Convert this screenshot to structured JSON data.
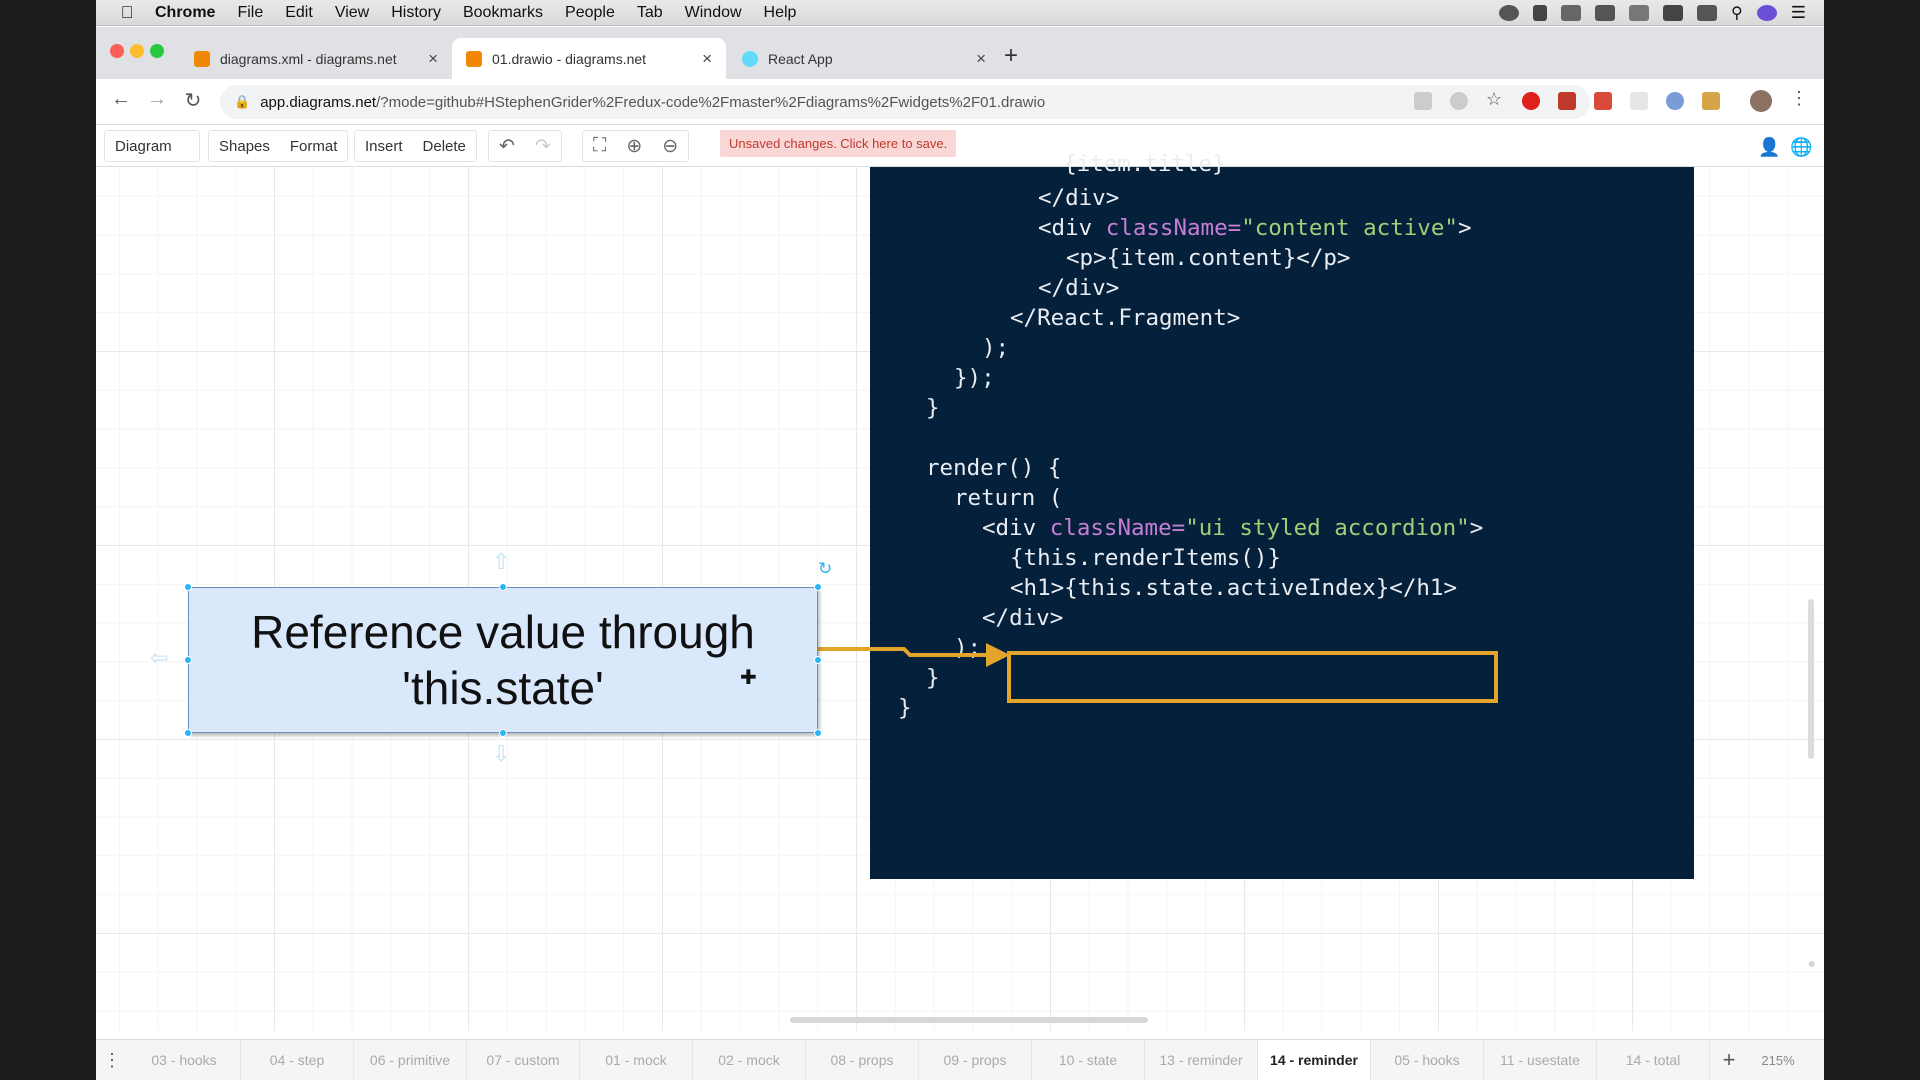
{
  "menubar": {
    "app": "Chrome",
    "items": [
      "File",
      "Edit",
      "View",
      "History",
      "Bookmarks",
      "People",
      "Tab",
      "Window",
      "Help"
    ]
  },
  "tabs": [
    {
      "title": "diagrams.xml - diagrams.net",
      "active": false
    },
    {
      "title": "01.drawio - diagrams.net",
      "active": true
    },
    {
      "title": "React App",
      "active": false
    }
  ],
  "address": {
    "host": "app.diagrams.net",
    "path": "/?mode=github#HStephenGrider%2Fredux-code%2Fmaster%2Fdiagrams%2Fwidgets%2F01.drawio"
  },
  "drawio_toolbar": {
    "diagram": "Diagram",
    "shapes": "Shapes",
    "format": "Format",
    "insert": "Insert",
    "delete": "Delete",
    "unsaved": "Unsaved changes. Click here to save."
  },
  "shape": {
    "line1": "Reference value through",
    "line2": "'this.state'"
  },
  "code_lines": [
    "{item.title}",
    "</div>",
    "className=",
    "\"content active\"",
    "<p>{item.content}</p>",
    "</div>",
    "</React.Fragment>",
    ");",
    "});",
    "}",
    "render() {",
    "return (",
    "\"ui styled accordion\"",
    "{this.renderItems()}",
    "<h1>{this.state.activeIndex}</h1>",
    "</div>",
    ");",
    "}",
    "}"
  ],
  "code_tokens": {
    "div_open": "<div ",
    "close_bracket": ">"
  },
  "pages": [
    "03 - hooks",
    "04 - step",
    "06 - primitive",
    "07 - custom",
    "01 - mock",
    "02 - mock",
    "08 - props",
    "09 - props",
    "10 - state",
    "13 - reminder",
    "14 - reminder",
    "05 - hooks",
    "11 - usestate",
    "14 - total"
  ],
  "active_page": "14 - reminder",
  "zoom": "215%",
  "colors": {
    "code_bg": "#04203b",
    "highlight": "#e2a42a",
    "shape_fill": "#dae8fc"
  }
}
